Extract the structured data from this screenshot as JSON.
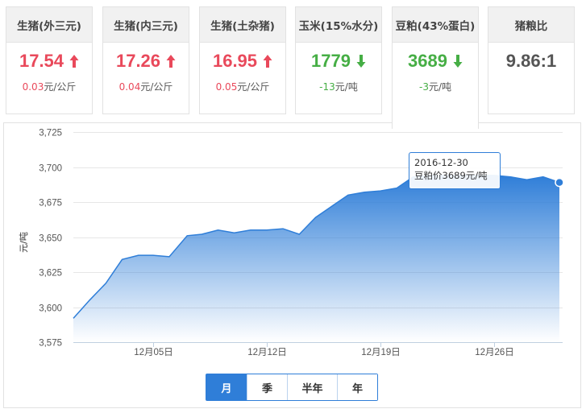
{
  "cards": [
    {
      "name": "生猪(外三元)",
      "price": "17.54",
      "direction": "up",
      "change": "0.03",
      "unit": "元/公斤"
    },
    {
      "name": "生猪(内三元)",
      "price": "17.26",
      "direction": "up",
      "change": "0.04",
      "unit": "元/公斤"
    },
    {
      "name": "生猪(土杂猪)",
      "price": "16.95",
      "direction": "up",
      "change": "0.05",
      "unit": "元/公斤"
    },
    {
      "name": "玉米(15%水分)",
      "price": "1779",
      "direction": "down",
      "change": "-13",
      "unit": "元/吨"
    },
    {
      "name": "豆粕(43%蛋白)",
      "price": "3689",
      "direction": "down",
      "change": "-3",
      "unit": "元/吨"
    },
    {
      "name": "猪粮比",
      "price": "9.86:1"
    }
  ],
  "active_card": 4,
  "colors": {
    "up": "#e9495b",
    "down": "#46ae45",
    "accent": "#2f7ed8"
  },
  "tooltip": {
    "date": "2016-12-30",
    "label": "豆粕价3689元/吨"
  },
  "range_tabs": [
    "月",
    "季",
    "半年",
    "年"
  ],
  "selected_range": "月",
  "chart_data": {
    "type": "area",
    "ylabel": "元/吨",
    "ylim": [
      3575,
      3725
    ],
    "y_ticks": [
      3575,
      3600,
      3625,
      3650,
      3675,
      3700,
      3725
    ],
    "y_tick_labels": [
      "3,575",
      "3,600",
      "3,625",
      "3,650",
      "3,675",
      "3,700",
      "3,725"
    ],
    "x_tick_labels": [
      "12月05日",
      "12月12日",
      "12月19日",
      "12月26日"
    ],
    "x_ticks_day": [
      5,
      12,
      19,
      26
    ],
    "x_range_day": [
      0.1,
      30.2
    ],
    "grid": true,
    "series": [
      {
        "day": [
          0.1,
          1.1,
          2.1,
          3.1,
          4.1,
          5.0,
          6.0,
          7.1,
          8.0,
          9.0,
          10.0,
          11.0,
          12.0,
          13.0,
          14.0,
          15.0,
          16.0,
          17.0,
          18.0,
          19.0,
          20.0,
          21.0,
          22.0,
          23.0,
          24.0,
          25.0,
          26.0,
          27.0,
          28.0,
          29.0,
          30.0
        ],
        "values": [
          3592,
          3605,
          3617,
          3634,
          3637,
          3637,
          3636,
          3651,
          3652,
          3655,
          3653,
          3655,
          3655,
          3656,
          3652,
          3664,
          3672,
          3680,
          3682,
          3683,
          3685,
          3693,
          3694,
          3694,
          3694,
          3694,
          3694,
          3693,
          3691,
          3693,
          3689
        ]
      }
    ]
  }
}
